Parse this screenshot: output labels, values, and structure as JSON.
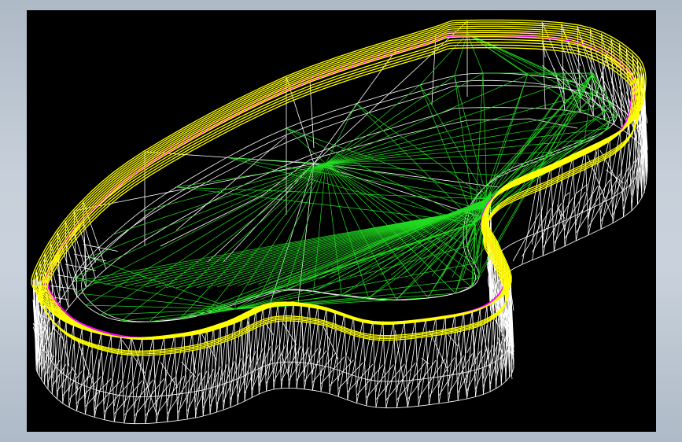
{
  "viewport": {
    "background_color": "#000000",
    "frame_color": "#b9c3ce",
    "render_mode": "wireframe",
    "colors": {
      "edge_primary": "#ffffff",
      "contour": "#ffff00",
      "contour_accent": "#ff00ff",
      "triangulation": "#22dd22"
    }
  }
}
